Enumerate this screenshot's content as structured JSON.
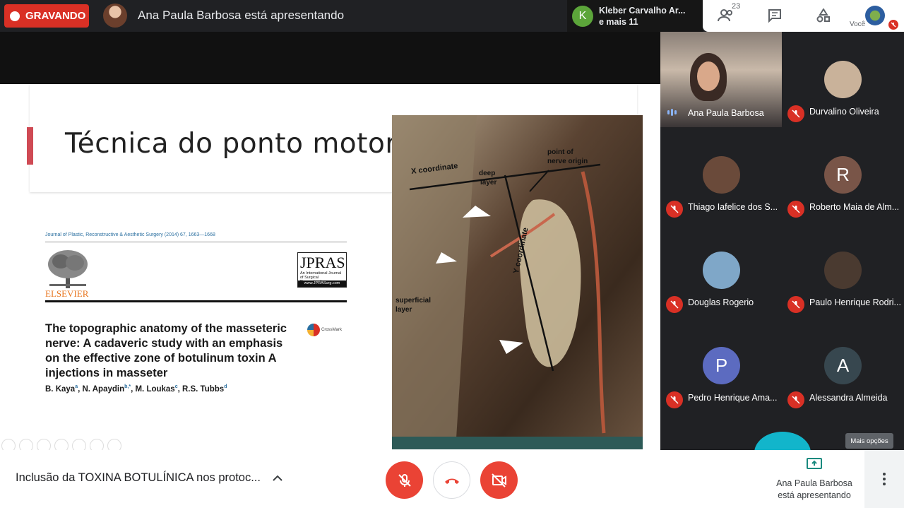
{
  "topbar": {
    "recording_label": "GRAVANDO",
    "presenting_label": "Ana Paula Barbosa está apresentando",
    "joiner_initial": "K",
    "joiner_line1": "Kleber Carvalho Ar...",
    "joiner_line2": "e mais 11",
    "people_count": "23",
    "self_label": "Você"
  },
  "slide": {
    "title": "Técnica do ponto motor",
    "journal_line": "Journal of Plastic, Reconstructive & Aesthetic Surgery (2014) 67, 1663—1668",
    "publisher": "ELSEVIER",
    "jpras_name": "JPRAS",
    "jpras_sub": "An International Journal of Surgical Reconstruction",
    "jpras_url": "www.JPRASurg.com",
    "crossmark": "CrossMark",
    "paper_title": "The topographic anatomy of the masseteric nerve: A cadaveric study with an emphasis on the effective zone of botulinum toxin A injections in masseter",
    "authors": [
      {
        "name": "B. Kaya",
        "sup": "a"
      },
      {
        "name": "N. Apaydin",
        "sup": "b,*"
      },
      {
        "name": "M. Loukas",
        "sup": "c"
      },
      {
        "name": "R.S. Tubbs",
        "sup": "d"
      }
    ],
    "image_labels": {
      "x_coord": "X coordinate",
      "deep": "deep",
      "layer1": "layer",
      "point_of": "point of",
      "nerve_origin": "nerve origin",
      "y_coord": "Y coordinate",
      "superficial": "superficial",
      "layer2": "layer"
    }
  },
  "participants": [
    {
      "name": "Ana Paula Barbosa",
      "type": "video",
      "speaking": true
    },
    {
      "name": "Durvalino Oliveira",
      "type": "photo",
      "muted": true,
      "color": "#c9b29a"
    },
    {
      "name": "Thiago Iafelice dos S...",
      "type": "photo",
      "muted": true,
      "color": "#6a4a3a"
    },
    {
      "name": "Roberto Maia de Alm...",
      "type": "initial",
      "initial": "R",
      "muted": true,
      "color": "#795548"
    },
    {
      "name": "Douglas Rogerio",
      "type": "photo",
      "muted": true,
      "color": "#7fa7c8"
    },
    {
      "name": "Paulo Henrique Rodri...",
      "type": "photo",
      "muted": true,
      "color": "#4a3a30"
    },
    {
      "name": "Pedro Henrique Ama...",
      "type": "initial",
      "initial": "P",
      "muted": true,
      "color": "#5c6bc0"
    },
    {
      "name": "Alessandra Almeida",
      "type": "initial",
      "initial": "A",
      "muted": true,
      "color": "#37474f"
    }
  ],
  "more_options_tooltip": "Mais opções",
  "bottombar": {
    "meeting_title": "Inclusão da TOXINA BOTULÍNICA nos protoc...",
    "present_line1": "Ana Paula Barbosa",
    "present_line2": "está apresentando"
  },
  "colors": {
    "recording": "#d93025",
    "danger_button": "#ea4335",
    "slide_accent": "#cf4a54",
    "speaking": "#8ab4f8"
  }
}
